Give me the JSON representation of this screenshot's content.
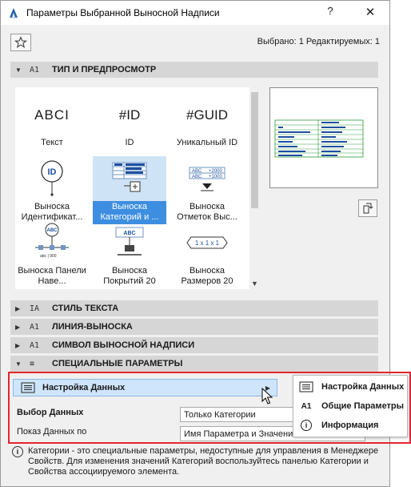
{
  "window": {
    "title": "Параметры Выбранной Выносной Надписи",
    "selected_info": "Выбрано: 1 Редактируемых: 1"
  },
  "sections": {
    "type_preview": {
      "label": "ТИП И ПРЕДПРОСМОТР",
      "icon": "label-type-icon",
      "icon_text": "A1"
    },
    "text_style": {
      "label": "СТИЛЬ ТЕКСТА",
      "icon_text": "IA"
    },
    "leader": {
      "label": "ЛИНИЯ-ВЫНОСКА",
      "icon_text": "A1"
    },
    "label_symbol": {
      "label": "СИМВОЛ ВЫНОСНОЙ НАДПИСИ",
      "icon_text": "A1"
    },
    "custom": {
      "label": "СПЕЦИАЛЬНЫЕ ПАРАМЕТРЫ",
      "icon_text": "≡"
    }
  },
  "gallery": [
    {
      "icon_text": "ABCI",
      "label": "Текст"
    },
    {
      "icon_text": "#ID",
      "label": "ID"
    },
    {
      "icon_text": "#GUID",
      "label": "Уникальный ID"
    },
    {
      "icon_text": "ID",
      "label": "Выноска Идентификат..."
    },
    {
      "icon_text": "ABC",
      "label": "Выноска Категорий и ...",
      "selected": true
    },
    {
      "icon_text": "ABC +2000",
      "label": "Выноска Отметок Выс..."
    },
    {
      "icon_text": "ABC",
      "label": "Выноска Панели Наве..."
    },
    {
      "icon_text": "ABC",
      "label": "Выноска Покрытий 20"
    },
    {
      "icon_text": "1 x 1 x 1",
      "label": "Выноска Размеров 20"
    }
  ],
  "custom_params": {
    "data_button": "Настройка Данных",
    "rows": [
      {
        "label": "Выбор Данных",
        "value": "Только Категории"
      },
      {
        "label": "Показ Данных по",
        "value": "Имя Параметра и Значение"
      }
    ]
  },
  "popup_menu": [
    {
      "label": "Настройка Данных",
      "icon": "list-icon"
    },
    {
      "label": "Общие Параметры",
      "icon": "label-icon",
      "icon_text": "A1"
    },
    {
      "label": "Информация",
      "icon": "info-icon",
      "icon_text": "i"
    }
  ],
  "info_text": "Категории - это специальные параметры, недоступные для управления в Менеджере Свойств. Для изменения значений Категорий воспользуйтесь панелью Категории и Свойства ассоциируемого элемента.",
  "colors": {
    "selection": "#3d8ee0",
    "highlight_box": "#e3262e",
    "data_button_bg": "#cfe5fb"
  }
}
